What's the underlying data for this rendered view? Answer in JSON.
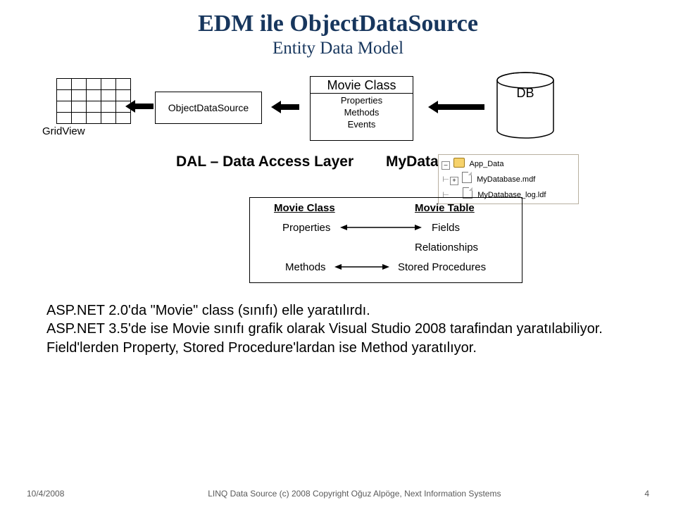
{
  "header": {
    "title": "EDM ile ObjectDataSource",
    "subtitle": "Entity Data Model"
  },
  "top": {
    "gridview_label": "GridView",
    "objectdatasource_label": "ObjectDataSource",
    "movieclass": {
      "title": "Movie Class",
      "line1": "Properties",
      "line2": "Methods",
      "line3": "Events"
    },
    "db_label": "DB",
    "dal_label": "DAL – Data Access Layer",
    "mdf_label": "MyDatabase.mdf"
  },
  "tree": {
    "folder": "App_Data",
    "file1": "MyDatabase.mdf",
    "file2": "MyDatabase_log.ldf"
  },
  "mapping": {
    "left_title": "Movie Class",
    "right_title": "Movie Table",
    "left_row1": "Properties",
    "right_row1": "Fields",
    "right_row2": "Relationships",
    "left_row3": "Methods",
    "right_row3": "Stored Procedures"
  },
  "body": {
    "line1": "ASP.NET 2.0'da \"Movie\" class (sınıfı) elle yaratılırdı.",
    "line2": "ASP.NET 3.5'de ise Movie sınıfı grafik olarak Visual Studio 2008 tarafindan yaratılabiliyor.",
    "line3": "Field'lerden Property, Stored Procedure'lardan ise Method yaratılıyor."
  },
  "footer": {
    "date": "10/4/2008",
    "copyright": "LINQ Data Source (c) 2008 Copyright Oğuz Alpöge, Next Information Systems",
    "page": "4"
  }
}
